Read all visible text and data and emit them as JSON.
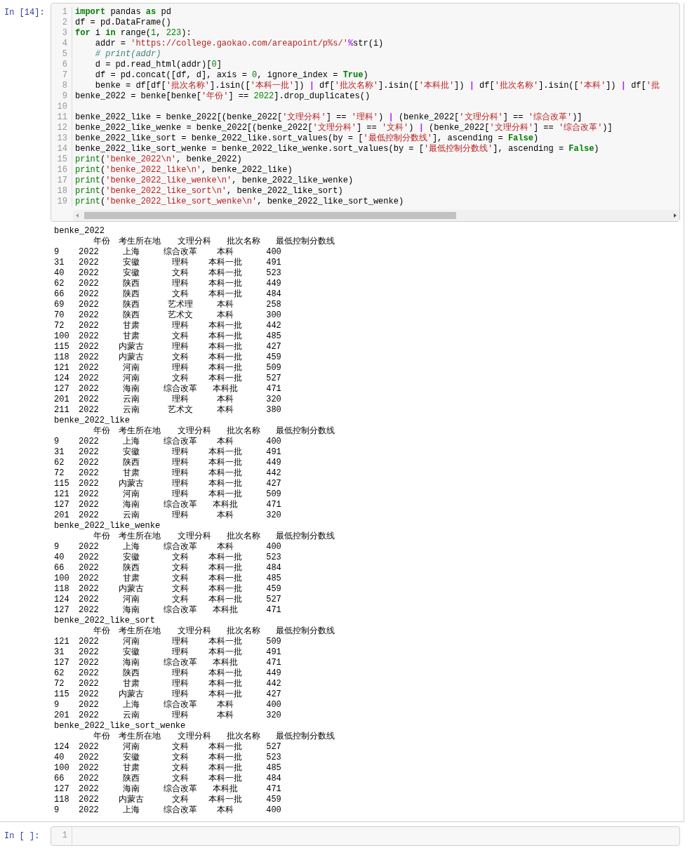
{
  "cell": {
    "prompt": "In [14]:",
    "code_lines": [
      {
        "number": "1",
        "tokens": [
          {
            "kind": "kw",
            "text": "import"
          },
          {
            "kind": "plain",
            "text": " pandas "
          },
          {
            "kind": "kw",
            "text": "as"
          },
          {
            "kind": "plain",
            "text": " pd"
          }
        ]
      },
      {
        "number": "2",
        "tokens": [
          {
            "kind": "plain",
            "text": "df = pd.DataFrame()"
          }
        ]
      },
      {
        "number": "3",
        "tokens": [
          {
            "kind": "kw",
            "text": "for"
          },
          {
            "kind": "plain",
            "text": " i "
          },
          {
            "kind": "kw",
            "text": "in"
          },
          {
            "kind": "plain",
            "text": " range("
          },
          {
            "kind": "num",
            "text": "1"
          },
          {
            "kind": "plain",
            "text": ", "
          },
          {
            "kind": "num",
            "text": "223"
          },
          {
            "kind": "plain",
            "text": "):"
          }
        ]
      },
      {
        "number": "4",
        "tokens": [
          {
            "kind": "plain",
            "text": "    addr = "
          },
          {
            "kind": "str",
            "text": "'https://college.gaokao.com/areapoint/p%s/'"
          },
          {
            "kind": "op",
            "text": "%"
          },
          {
            "kind": "plain",
            "text": "str(i)"
          }
        ]
      },
      {
        "number": "5",
        "tokens": [
          {
            "kind": "com",
            "text": "    # print(addr)"
          }
        ]
      },
      {
        "number": "6",
        "tokens": [
          {
            "kind": "plain",
            "text": "    d = pd.read_html(addr)["
          },
          {
            "kind": "num",
            "text": "0"
          },
          {
            "kind": "plain",
            "text": "]"
          }
        ]
      },
      {
        "number": "7",
        "tokens": [
          {
            "kind": "plain",
            "text": "    df = pd.concat([df, d], axis = "
          },
          {
            "kind": "num",
            "text": "0"
          },
          {
            "kind": "plain",
            "text": ", ignore_index = "
          },
          {
            "kind": "kw",
            "text": "True"
          },
          {
            "kind": "plain",
            "text": ")"
          }
        ]
      },
      {
        "number": "8",
        "tokens": [
          {
            "kind": "plain",
            "text": "    benke = df[df["
          },
          {
            "kind": "str",
            "text": "'批次名称'"
          },
          {
            "kind": "plain",
            "text": "].isin(["
          },
          {
            "kind": "str",
            "text": "'本科一批'"
          },
          {
            "kind": "plain",
            "text": "]) "
          },
          {
            "kind": "op",
            "text": "|"
          },
          {
            "kind": "plain",
            "text": " df["
          },
          {
            "kind": "str",
            "text": "'批次名称'"
          },
          {
            "kind": "plain",
            "text": "].isin(["
          },
          {
            "kind": "str",
            "text": "'本科批'"
          },
          {
            "kind": "plain",
            "text": "]) "
          },
          {
            "kind": "op",
            "text": "|"
          },
          {
            "kind": "plain",
            "text": " df["
          },
          {
            "kind": "str",
            "text": "'批次名称'"
          },
          {
            "kind": "plain",
            "text": "].isin(["
          },
          {
            "kind": "str",
            "text": "'本科'"
          },
          {
            "kind": "plain",
            "text": "]) "
          },
          {
            "kind": "op",
            "text": "|"
          },
          {
            "kind": "plain",
            "text": " df["
          },
          {
            "kind": "str",
            "text": "'批"
          }
        ]
      },
      {
        "number": "9",
        "tokens": [
          {
            "kind": "plain",
            "text": "benke_2022 = benke[benke["
          },
          {
            "kind": "str",
            "text": "'年份'"
          },
          {
            "kind": "plain",
            "text": "] == "
          },
          {
            "kind": "num",
            "text": "2022"
          },
          {
            "kind": "plain",
            "text": "].drop_duplicates()"
          }
        ]
      },
      {
        "number": "10"
      },
      {
        "number": "11",
        "tokens": [
          {
            "kind": "plain",
            "text": "benke_2022_like = benke_2022[(benke_2022["
          },
          {
            "kind": "str",
            "text": "'文理分科'"
          },
          {
            "kind": "plain",
            "text": "] == "
          },
          {
            "kind": "str",
            "text": "'理科'"
          },
          {
            "kind": "plain",
            "text": ") "
          },
          {
            "kind": "op",
            "text": "|"
          },
          {
            "kind": "plain",
            "text": " (benke_2022["
          },
          {
            "kind": "str",
            "text": "'文理分科'"
          },
          {
            "kind": "plain",
            "text": "] == "
          },
          {
            "kind": "str",
            "text": "'综合改革'"
          },
          {
            "kind": "plain",
            "text": ")]"
          }
        ]
      },
      {
        "number": "12",
        "tokens": [
          {
            "kind": "plain",
            "text": "benke_2022_like_wenke = benke_2022[(benke_2022["
          },
          {
            "kind": "str",
            "text": "'文理分科'"
          },
          {
            "kind": "plain",
            "text": "] == "
          },
          {
            "kind": "str",
            "text": "'文科'"
          },
          {
            "kind": "plain",
            "text": ") "
          },
          {
            "kind": "op",
            "text": "|"
          },
          {
            "kind": "plain",
            "text": " (benke_2022["
          },
          {
            "kind": "str",
            "text": "'文理分科'"
          },
          {
            "kind": "plain",
            "text": "] == "
          },
          {
            "kind": "str",
            "text": "'综合改革'"
          },
          {
            "kind": "plain",
            "text": ")]"
          }
        ]
      },
      {
        "number": "13",
        "tokens": [
          {
            "kind": "plain",
            "text": "benke_2022_like_sort = benke_2022_like.sort_values(by = ["
          },
          {
            "kind": "str",
            "text": "'最低控制分数线'"
          },
          {
            "kind": "plain",
            "text": "], ascending = "
          },
          {
            "kind": "kw",
            "text": "False"
          },
          {
            "kind": "plain",
            "text": ")"
          }
        ]
      },
      {
        "number": "14",
        "tokens": [
          {
            "kind": "plain",
            "text": "benke_2022_like_sort_wenke = benke_2022_like_wenke.sort_values(by = ["
          },
          {
            "kind": "str",
            "text": "'最低控制分数线'"
          },
          {
            "kind": "plain",
            "text": "], ascending = "
          },
          {
            "kind": "kw",
            "text": "False"
          },
          {
            "kind": "plain",
            "text": ")"
          }
        ]
      },
      {
        "number": "15",
        "tokens": [
          {
            "kind": "builtin",
            "text": "print"
          },
          {
            "kind": "plain",
            "text": "("
          },
          {
            "kind": "str",
            "text": "'benke_2022\\n'"
          },
          {
            "kind": "plain",
            "text": ", benke_2022)"
          }
        ]
      },
      {
        "number": "16",
        "tokens": [
          {
            "kind": "builtin",
            "text": "print"
          },
          {
            "kind": "plain",
            "text": "("
          },
          {
            "kind": "str",
            "text": "'benke_2022_like\\n'"
          },
          {
            "kind": "plain",
            "text": ", benke_2022_like)"
          }
        ]
      },
      {
        "number": "17",
        "tokens": [
          {
            "kind": "builtin",
            "text": "print"
          },
          {
            "kind": "plain",
            "text": "("
          },
          {
            "kind": "str",
            "text": "'benke_2022_like_wenke\\n'"
          },
          {
            "kind": "plain",
            "text": ", benke_2022_like_wenke)"
          }
        ]
      },
      {
        "number": "18",
        "tokens": [
          {
            "kind": "builtin",
            "text": "print"
          },
          {
            "kind": "plain",
            "text": "("
          },
          {
            "kind": "str",
            "text": "'benke_2022_like_sort\\n'"
          },
          {
            "kind": "plain",
            "text": ", benke_2022_like_sort)"
          }
        ]
      },
      {
        "number": "19",
        "tokens": [
          {
            "kind": "builtin",
            "text": "print"
          },
          {
            "kind": "plain",
            "text": "("
          },
          {
            "kind": "str",
            "text": "'benke_2022_like_sort_wenke\\n'"
          },
          {
            "kind": "plain",
            "text": ", benke_2022_like_sort_wenke)"
          }
        ]
      }
    ],
    "output": [
      {
        "title": "benke_2022",
        "header": [
          "年份",
          "考生所在地",
          "文理分科",
          "批次名称",
          "最低控制分数线"
        ],
        "rows": [
          [
            "9",
            "2022",
            "上海",
            "综合改革",
            "本科",
            "400"
          ],
          [
            "31",
            "2022",
            "安徽",
            "理科",
            "本科一批",
            "491"
          ],
          [
            "40",
            "2022",
            "安徽",
            "文科",
            "本科一批",
            "523"
          ],
          [
            "62",
            "2022",
            "陕西",
            "理科",
            "本科一批",
            "449"
          ],
          [
            "66",
            "2022",
            "陕西",
            "文科",
            "本科一批",
            "484"
          ],
          [
            "69",
            "2022",
            "陕西",
            "艺术理",
            "本科",
            "258"
          ],
          [
            "70",
            "2022",
            "陕西",
            "艺术文",
            "本科",
            "300"
          ],
          [
            "72",
            "2022",
            "甘肃",
            "理科",
            "本科一批",
            "442"
          ],
          [
            "100",
            "2022",
            "甘肃",
            "文科",
            "本科一批",
            "485"
          ],
          [
            "115",
            "2022",
            "内蒙古",
            "理科",
            "本科一批",
            "427"
          ],
          [
            "118",
            "2022",
            "内蒙古",
            "文科",
            "本科一批",
            "459"
          ],
          [
            "121",
            "2022",
            "河南",
            "理科",
            "本科一批",
            "509"
          ],
          [
            "124",
            "2022",
            "河南",
            "文科",
            "本科一批",
            "527"
          ],
          [
            "127",
            "2022",
            "海南",
            "综合改革",
            "本科批",
            "471"
          ],
          [
            "201",
            "2022",
            "云南",
            "理科",
            "本科",
            "320"
          ],
          [
            "211",
            "2022",
            "云南",
            "艺术文",
            "本科",
            "380"
          ]
        ]
      },
      {
        "title": "benke_2022_like",
        "header": [
          "年份",
          "考生所在地",
          "文理分科",
          "批次名称",
          "最低控制分数线"
        ],
        "rows": [
          [
            "9",
            "2022",
            "上海",
            "综合改革",
            "本科",
            "400"
          ],
          [
            "31",
            "2022",
            "安徽",
            "理科",
            "本科一批",
            "491"
          ],
          [
            "62",
            "2022",
            "陕西",
            "理科",
            "本科一批",
            "449"
          ],
          [
            "72",
            "2022",
            "甘肃",
            "理科",
            "本科一批",
            "442"
          ],
          [
            "115",
            "2022",
            "内蒙古",
            "理科",
            "本科一批",
            "427"
          ],
          [
            "121",
            "2022",
            "河南",
            "理科",
            "本科一批",
            "509"
          ],
          [
            "127",
            "2022",
            "海南",
            "综合改革",
            "本科批",
            "471"
          ],
          [
            "201",
            "2022",
            "云南",
            "理科",
            "本科",
            "320"
          ]
        ]
      },
      {
        "title": "benke_2022_like_wenke",
        "header": [
          "年份",
          "考生所在地",
          "文理分科",
          "批次名称",
          "最低控制分数线"
        ],
        "rows": [
          [
            "9",
            "2022",
            "上海",
            "综合改革",
            "本科",
            "400"
          ],
          [
            "40",
            "2022",
            "安徽",
            "文科",
            "本科一批",
            "523"
          ],
          [
            "66",
            "2022",
            "陕西",
            "文科",
            "本科一批",
            "484"
          ],
          [
            "100",
            "2022",
            "甘肃",
            "文科",
            "本科一批",
            "485"
          ],
          [
            "118",
            "2022",
            "内蒙古",
            "文科",
            "本科一批",
            "459"
          ],
          [
            "124",
            "2022",
            "河南",
            "文科",
            "本科一批",
            "527"
          ],
          [
            "127",
            "2022",
            "海南",
            "综合改革",
            "本科批",
            "471"
          ]
        ]
      },
      {
        "title": "benke_2022_like_sort",
        "header": [
          "年份",
          "考生所在地",
          "文理分科",
          "批次名称",
          "最低控制分数线"
        ],
        "rows": [
          [
            "121",
            "2022",
            "河南",
            "理科",
            "本科一批",
            "509"
          ],
          [
            "31",
            "2022",
            "安徽",
            "理科",
            "本科一批",
            "491"
          ],
          [
            "127",
            "2022",
            "海南",
            "综合改革",
            "本科批",
            "471"
          ],
          [
            "62",
            "2022",
            "陕西",
            "理科",
            "本科一批",
            "449"
          ],
          [
            "72",
            "2022",
            "甘肃",
            "理科",
            "本科一批",
            "442"
          ],
          [
            "115",
            "2022",
            "内蒙古",
            "理科",
            "本科一批",
            "427"
          ],
          [
            "9",
            "2022",
            "上海",
            "综合改革",
            "本科",
            "400"
          ],
          [
            "201",
            "2022",
            "云南",
            "理科",
            "本科",
            "320"
          ]
        ]
      },
      {
        "title": "benke_2022_like_sort_wenke",
        "header": [
          "年份",
          "考生所在地",
          "文理分科",
          "批次名称",
          "最低控制分数线"
        ],
        "rows": [
          [
            "124",
            "2022",
            "河南",
            "文科",
            "本科一批",
            "527"
          ],
          [
            "40",
            "2022",
            "安徽",
            "文科",
            "本科一批",
            "523"
          ],
          [
            "100",
            "2022",
            "甘肃",
            "文科",
            "本科一批",
            "485"
          ],
          [
            "66",
            "2022",
            "陕西",
            "文科",
            "本科一批",
            "484"
          ],
          [
            "127",
            "2022",
            "海南",
            "综合改革",
            "本科批",
            "471"
          ],
          [
            "118",
            "2022",
            "内蒙古",
            "文科",
            "本科一批",
            "459"
          ],
          [
            "9",
            "2022",
            "上海",
            "综合改革",
            "本科",
            "400"
          ]
        ]
      }
    ]
  },
  "empty_cell": {
    "prompt": "In [ ]:",
    "line_number": "1"
  }
}
